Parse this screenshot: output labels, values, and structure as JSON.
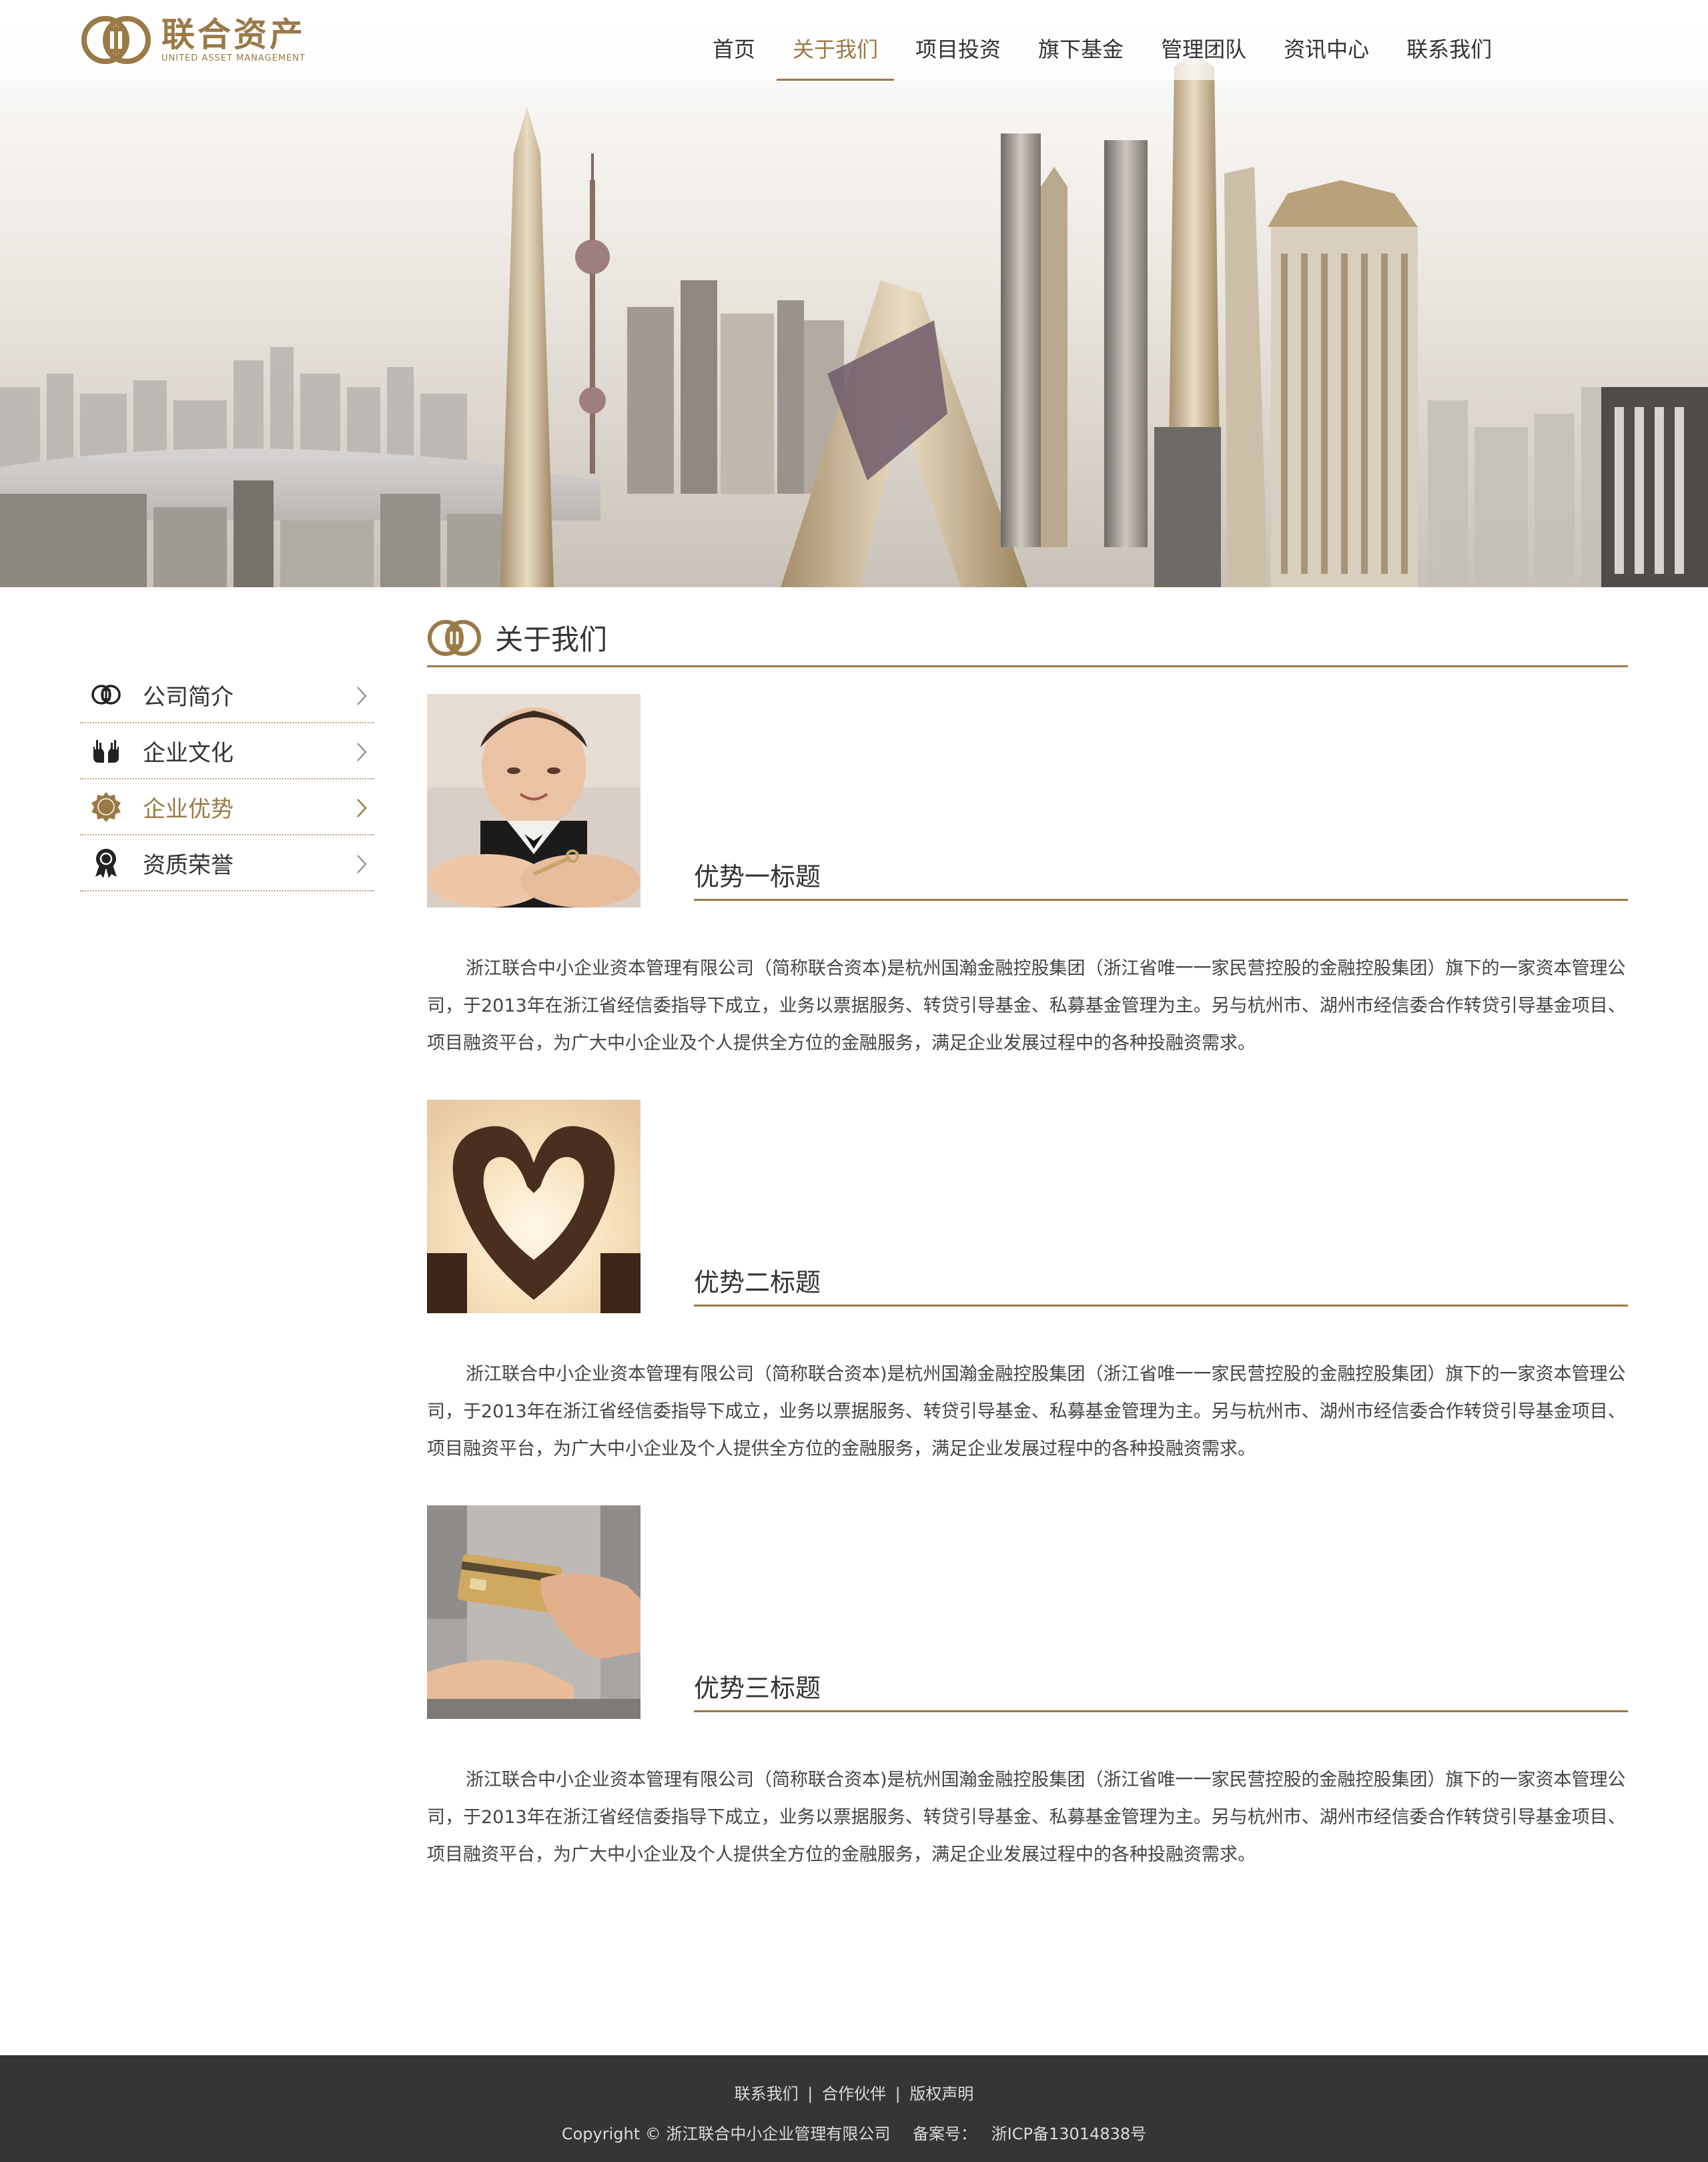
{
  "header": {
    "logo_cn": "联合资产",
    "logo_en": "UNITED ASSET MANAGEMENT",
    "nav": [
      {
        "label": "首页"
      },
      {
        "label": "关于我们",
        "active": true
      },
      {
        "label": "项目投资"
      },
      {
        "label": "旗下基金"
      },
      {
        "label": "管理团队"
      },
      {
        "label": "资讯中心"
      },
      {
        "label": "联系我们"
      }
    ]
  },
  "sidebar": {
    "items": [
      {
        "label": "公司简介",
        "icon": "company-logo-icon"
      },
      {
        "label": "企业文化",
        "icon": "hands-icon"
      },
      {
        "label": "企业优势",
        "icon": "best-badge-icon",
        "active": true
      },
      {
        "label": "资质荣誉",
        "icon": "award-ribbon-icon"
      }
    ]
  },
  "main": {
    "section_title": "关于我们",
    "advantages": [
      {
        "title": "优势一标题",
        "image": "child-with-key-photo",
        "body": "浙江联合中小企业资本管理有限公司（简称联合资本)是杭州国瀚金融控股集团（浙江省唯一一家民营控股的金融控股集团）旗下的一家资本管理公司，于2013年在浙江省经信委指导下成立，业务以票据服务、转贷引导基金、私募基金管理为主。另与杭州市、湖州市经信委合作转贷引导基金项目、项目融资平台，为广大中小企业及个人提供全方位的金融服务，满足企业发展过程中的各种投融资需求。"
      },
      {
        "title": "优势二标题",
        "image": "heart-hands-photo",
        "body": "浙江联合中小企业资本管理有限公司（简称联合资本)是杭州国瀚金融控股集团（浙江省唯一一家民营控股的金融控股集团）旗下的一家资本管理公司，于2013年在浙江省经信委指导下成立，业务以票据服务、转贷引导基金、私募基金管理为主。另与杭州市、湖州市经信委合作转贷引导基金项目、项目融资平台，为广大中小企业及个人提供全方位的金融服务，满足企业发展过程中的各种投融资需求。"
      },
      {
        "title": "优势三标题",
        "image": "credit-card-photo",
        "body": "浙江联合中小企业资本管理有限公司（简称联合资本)是杭州国瀚金融控股集团（浙江省唯一一家民营控股的金融控股集团）旗下的一家资本管理公司，于2013年在浙江省经信委指导下成立，业务以票据服务、转贷引导基金、私募基金管理为主。另与杭州市、湖州市经信委合作转贷引导基金项目、项目融资平台，为广大中小企业及个人提供全方位的金融服务，满足企业发展过程中的各种投融资需求。"
      }
    ]
  },
  "footer": {
    "links": [
      "联系我们",
      "合作伙伴",
      "版权声明"
    ],
    "separator": "|",
    "copyright": "Copyright © 浙江联合中小企业管理有限公司",
    "icp_label": "备案号：",
    "icp": "浙ICP备13014838号"
  },
  "colors": {
    "accent": "#9a7a47",
    "footer_bg": "#353535",
    "text": "#333333"
  }
}
